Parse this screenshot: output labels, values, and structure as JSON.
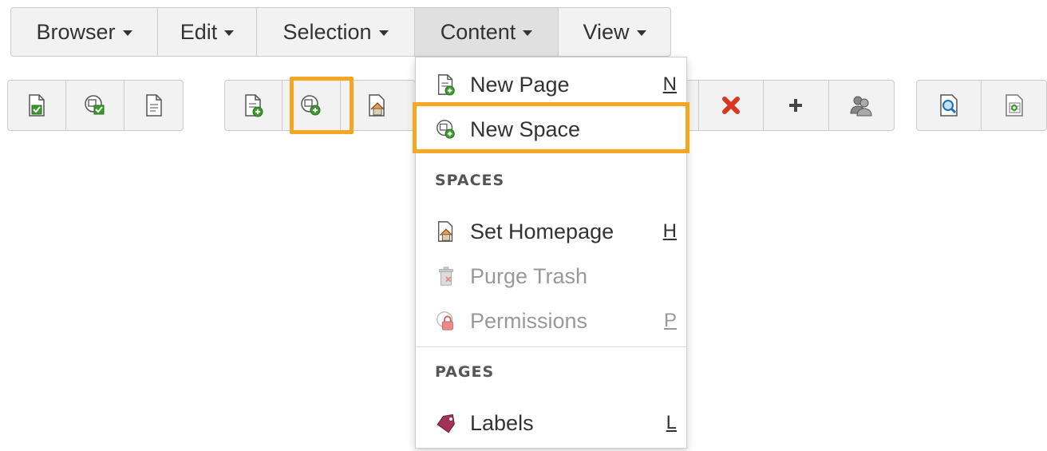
{
  "menubar": {
    "items": [
      {
        "label": "Browser"
      },
      {
        "label": "Edit"
      },
      {
        "label": "Selection"
      },
      {
        "label": "Content",
        "active": true
      },
      {
        "label": "View"
      }
    ]
  },
  "toolbar": {
    "group1": [
      "page-check-icon",
      "space-check-icon",
      "page-info-icon"
    ],
    "group2": [
      "new-page-icon",
      "new-space-icon",
      "home-icon"
    ],
    "group3": [
      "delete-icon",
      "add-icon",
      "users-icon"
    ],
    "group4": [
      "search-page-icon",
      "add-table-icon"
    ]
  },
  "content_menu": {
    "items": [
      {
        "label": "New Page",
        "shortcut": "N"
      },
      {
        "label": "New Space",
        "shortcut": ""
      }
    ],
    "spaces_header": "SPACES",
    "spaces_items": [
      {
        "label": "Set Homepage",
        "shortcut": "H",
        "disabled": false
      },
      {
        "label": "Purge Trash",
        "shortcut": "",
        "disabled": true
      },
      {
        "label": "Permissions",
        "shortcut": "P",
        "disabled": true
      }
    ],
    "pages_header": "PAGES",
    "pages_items": [
      {
        "label": "Labels",
        "shortcut": "L"
      }
    ]
  },
  "colors": {
    "highlight": "#f5a623",
    "accent_green": "#3c9a2e",
    "delete_red": "#d9381e"
  }
}
